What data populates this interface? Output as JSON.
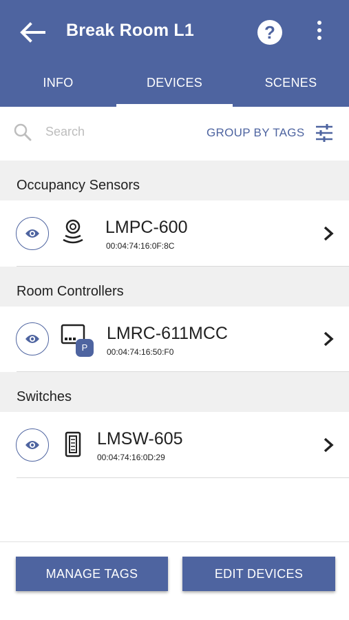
{
  "header": {
    "title": "Break Room L1",
    "help_label": "?"
  },
  "tabs": [
    {
      "label": "INFO",
      "active": false
    },
    {
      "label": "DEVICES",
      "active": true
    },
    {
      "label": "SCENES",
      "active": false
    }
  ],
  "search": {
    "placeholder": "Search",
    "value": "",
    "group_label": "GROUP BY TAGS"
  },
  "sections": [
    {
      "title": "Occupancy Sensors",
      "device": {
        "name": "LMPC-600",
        "mac": "00:04:74:16:0F:8C",
        "icon": "occupancy-sensor-icon"
      }
    },
    {
      "title": "Room Controllers",
      "device": {
        "name": "LMRC-611MCC",
        "mac": "00:04:74:16:50:F0",
        "icon": "room-controller-icon",
        "badge": "P"
      }
    },
    {
      "title": "Switches",
      "device": {
        "name": "LMSW-605",
        "mac": "00:04:74:16:0D:29",
        "icon": "switch-icon"
      }
    }
  ],
  "footer": {
    "manage_tags_label": "MANAGE TAGS",
    "edit_devices_label": "EDIT DEVICES"
  },
  "colors": {
    "primary": "#4e64a0",
    "section_bg": "#f0f0f0"
  }
}
